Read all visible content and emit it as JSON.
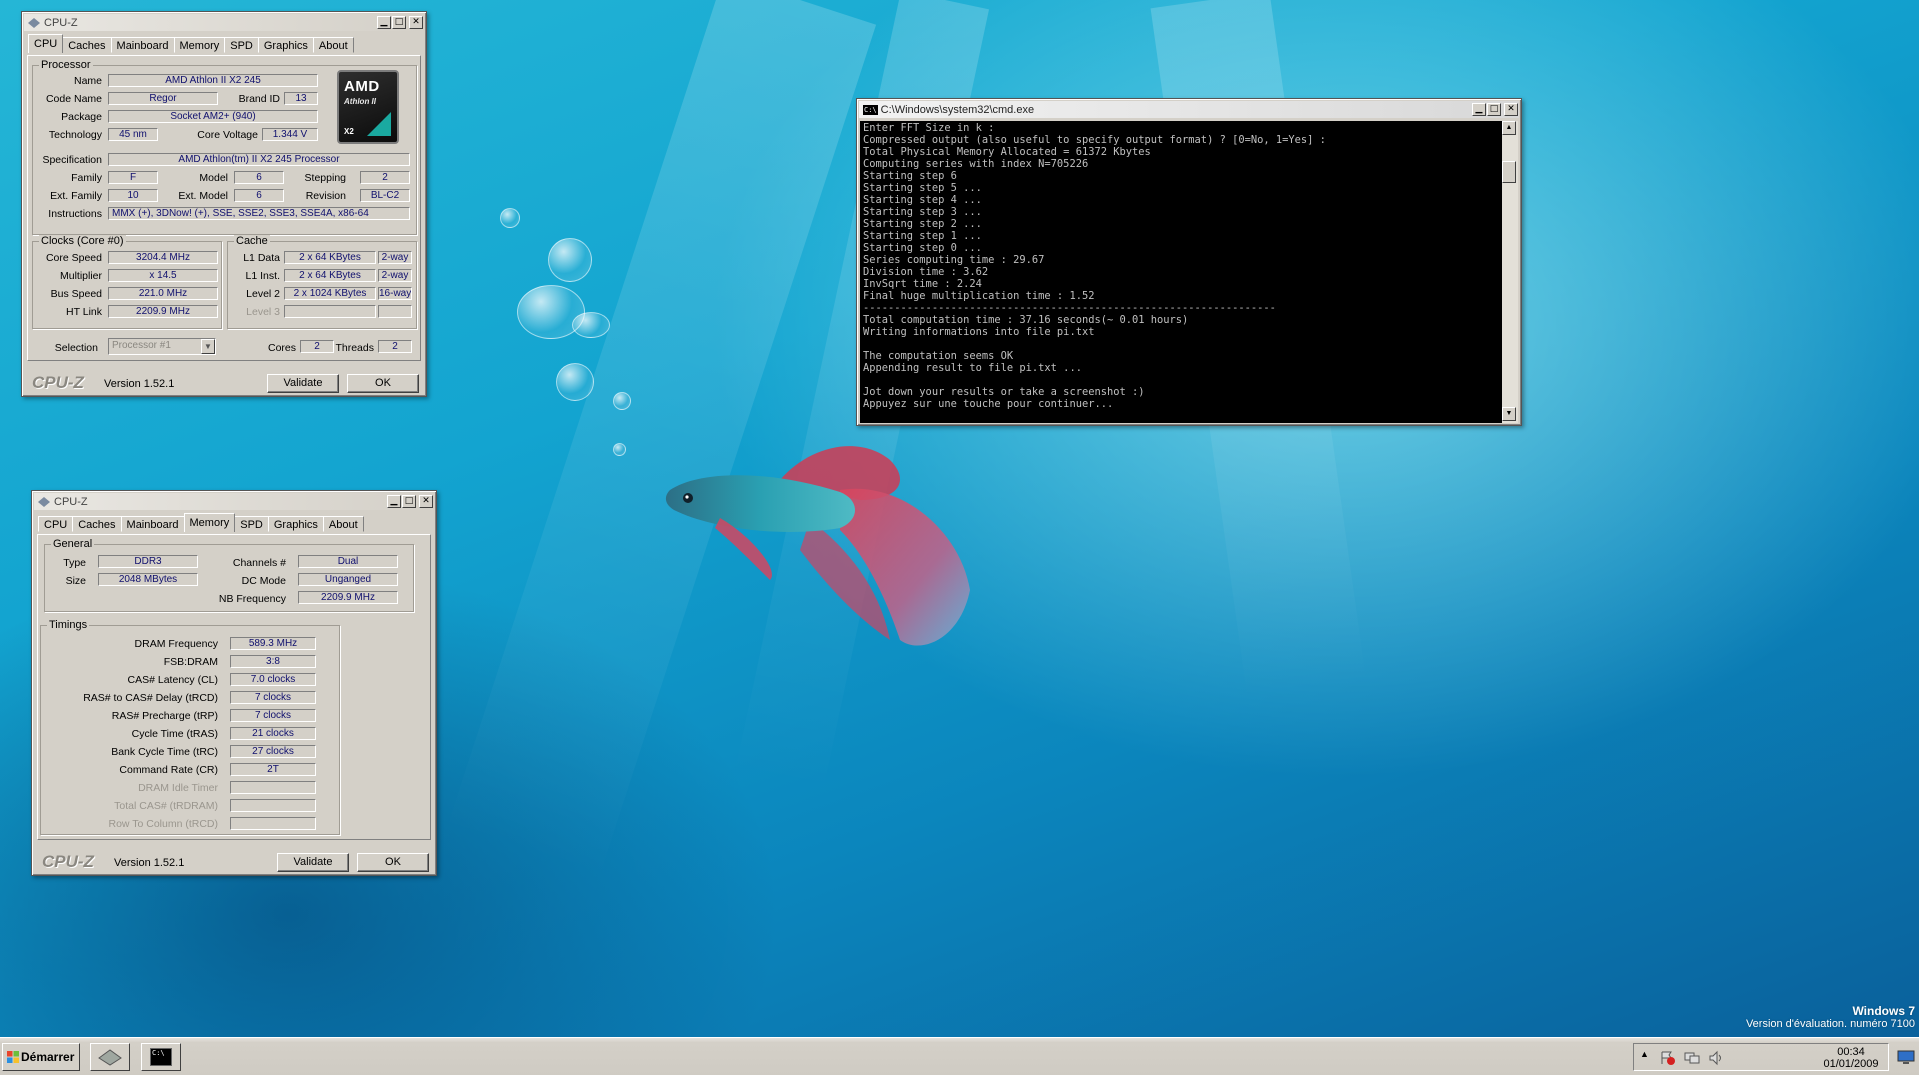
{
  "desktop": {
    "watermark_title": "Windows 7",
    "watermark_sub": "Version d'évaluation. numéro 7100"
  },
  "cpuz_cpu": {
    "title": "CPU-Z",
    "tabs": [
      "CPU",
      "Caches",
      "Mainboard",
      "Memory",
      "SPD",
      "Graphics",
      "About"
    ],
    "active_tab": "CPU",
    "processor": {
      "group": "Processor",
      "name_label": "Name",
      "name": "AMD Athlon II X2 245",
      "codename_label": "Code Name",
      "codename": "Regor",
      "brandid_label": "Brand ID",
      "brandid": "13",
      "package_label": "Package",
      "package": "Socket AM2+ (940)",
      "technology_label": "Technology",
      "technology": "45 nm",
      "voltage_label": "Core Voltage",
      "voltage": "1.344 V",
      "spec_label": "Specification",
      "spec": "AMD Athlon(tm) II X2 245 Processor",
      "family_label": "Family",
      "family": "F",
      "model_label": "Model",
      "model": "6",
      "stepping_label": "Stepping",
      "stepping": "2",
      "extfamily_label": "Ext. Family",
      "extfamily": "10",
      "extmodel_label": "Ext. Model",
      "extmodel": "6",
      "revision_label": "Revision",
      "revision": "BL-C2",
      "instr_label": "Instructions",
      "instr": "MMX (+), 3DNow! (+), SSE, SSE2, SSE3, SSE4A, x86-64",
      "logo_amd": "AMD",
      "logo_athlon": "Athlon II",
      "logo_x2": "X2"
    },
    "clocks": {
      "group": "Clocks (Core #0)",
      "corespeed_label": "Core Speed",
      "corespeed": "3204.4 MHz",
      "multiplier_label": "Multiplier",
      "multiplier": "x 14.5",
      "busspeed_label": "Bus Speed",
      "busspeed": "221.0 MHz",
      "htlink_label": "HT Link",
      "htlink": "2209.9 MHz"
    },
    "cache": {
      "group": "Cache",
      "l1d_label": "L1 Data",
      "l1d": "2 x 64 KBytes",
      "l1d_way": "2-way",
      "l1i_label": "L1 Inst.",
      "l1i": "2 x 64 KBytes",
      "l1i_way": "2-way",
      "l2_label": "Level 2",
      "l2": "2 x 1024 KBytes",
      "l2_way": "16-way",
      "l3_label": "Level 3"
    },
    "selection_label": "Selection",
    "selection": "Processor #1",
    "cores_label": "Cores",
    "cores": "2",
    "threads_label": "Threads",
    "threads": "2",
    "brand": "CPU-Z",
    "version": "Version 1.52.1",
    "validate": "Validate",
    "ok": "OK"
  },
  "cpuz_mem": {
    "title": "CPU-Z",
    "tabs": [
      "CPU",
      "Caches",
      "Mainboard",
      "Memory",
      "SPD",
      "Graphics",
      "About"
    ],
    "active_tab": "Memory",
    "general": {
      "group": "General",
      "type_label": "Type",
      "type": "DDR3",
      "size_label": "Size",
      "size": "2048 MBytes",
      "channels_label": "Channels #",
      "channels": "Dual",
      "dcmode_label": "DC Mode",
      "dcmode": "Unganged",
      "nbfreq_label": "NB Frequency",
      "nbfreq": "2209.9 MHz"
    },
    "timings": {
      "group": "Timings",
      "rows": [
        {
          "label": "DRAM Frequency",
          "value": "589.3 MHz"
        },
        {
          "label": "FSB:DRAM",
          "value": "3:8"
        },
        {
          "label": "CAS# Latency (CL)",
          "value": "7.0 clocks"
        },
        {
          "label": "RAS# to CAS# Delay (tRCD)",
          "value": "7 clocks"
        },
        {
          "label": "RAS# Precharge (tRP)",
          "value": "7 clocks"
        },
        {
          "label": "Cycle Time (tRAS)",
          "value": "21 clocks"
        },
        {
          "label": "Bank Cycle Time (tRC)",
          "value": "27 clocks"
        },
        {
          "label": "Command Rate (CR)",
          "value": "2T"
        },
        {
          "label": "DRAM Idle Timer",
          "value": ""
        },
        {
          "label": "Total CAS# (tRDRAM)",
          "value": ""
        },
        {
          "label": "Row To Column (tRCD)",
          "value": ""
        }
      ]
    },
    "brand": "CPU-Z",
    "version": "Version 1.52.1",
    "validate": "Validate",
    "ok": "OK"
  },
  "cmd": {
    "title": "C:\\Windows\\system32\\cmd.exe",
    "icon_text": "C:\\",
    "lines": [
      "Enter FFT Size in k :",
      "Compressed output (also useful to specify output format) ? [0=No, 1=Yes] :",
      "Total Physical Memory Allocated = 61372 Kbytes",
      "Computing series with index N=705226",
      "Starting step 6",
      "Starting step 5 ...",
      "Starting step 4 ...",
      "Starting step 3 ...",
      "Starting step 2 ...",
      "Starting step 1 ...",
      "Starting step 0 ...",
      "Series computing time : 29.67",
      "Division time : 3.62",
      "InvSqrt time : 2.24",
      "Final huge multiplication time : 1.52",
      "------------------------------------------------------------------",
      "Total computation time : 37.16 seconds(~ 0.01 hours)",
      "Writing informations into file pi.txt",
      "",
      "The computation seems OK",
      "Appending result to file pi.txt ...",
      "",
      "Jot down your results or take a screenshot :)",
      "Appuyez sur une touche pour continuer..."
    ]
  },
  "taskbar": {
    "start_label": "Démarrer",
    "task_cmd_icon": "C:\\",
    "time": "00:34",
    "date": "01/01/2009"
  }
}
